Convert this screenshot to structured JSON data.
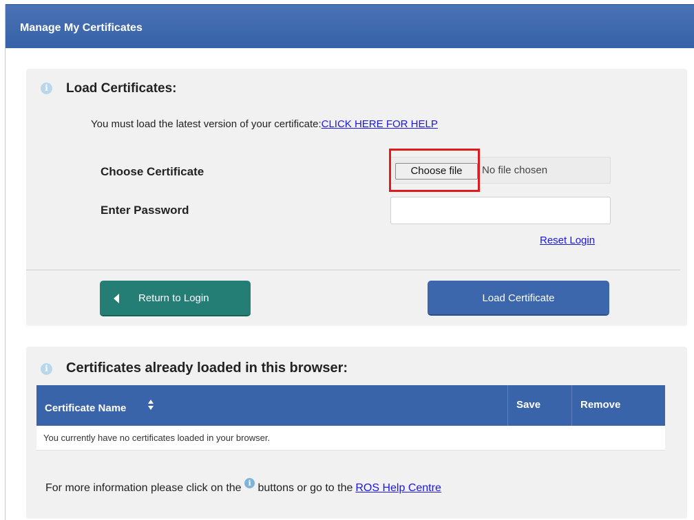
{
  "header": {
    "title": "Manage My Certificates"
  },
  "load_panel": {
    "title": "Load Certificates:",
    "help_prefix": "You must load the latest version of your certificate:",
    "help_link": "CLICK HERE FOR HELP",
    "choose_label": "Choose Certificate",
    "choose_button": "Choose file",
    "no_file_text": "No file chosen",
    "password_label": "Enter Password",
    "password_value": "",
    "reset_link": "Reset Login",
    "return_button": "Return to Login",
    "load_button": "Load Certificate"
  },
  "certs_panel": {
    "title": "Certificates already loaded in this browser:",
    "columns": [
      "Certificate Name",
      "Save",
      "Remove"
    ],
    "empty_message": "You currently have no certificates loaded in your browser.",
    "footer_prefix": "For more information please click on the",
    "footer_middle": "buttons or go to the",
    "footer_link": "ROS Help Centre"
  },
  "icons": {
    "info": "i"
  },
  "colors": {
    "header": "#3762a8",
    "return_button": "#247e76",
    "load_button": "#3d67ad",
    "link": "#1a16e6",
    "highlight": "#e01a1a"
  }
}
